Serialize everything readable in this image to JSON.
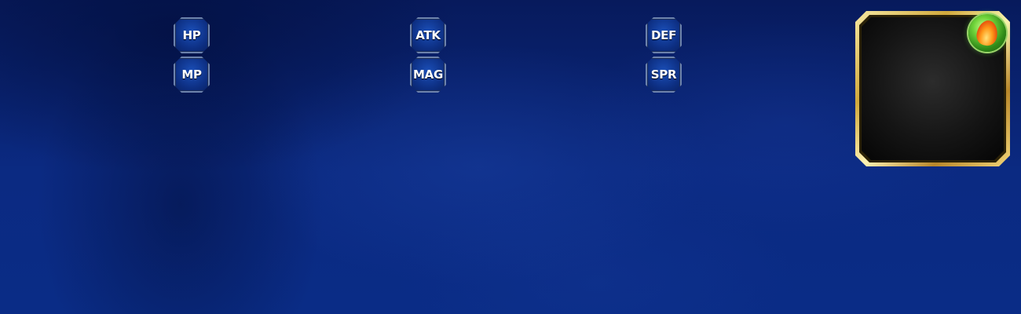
{
  "stats": {
    "hp": "HP",
    "mp": "MP",
    "atk": "ATK",
    "mag": "MAG",
    "def": "DEF",
    "spr": "SPR"
  },
  "portrait": {
    "frame_color": "#d4af37",
    "element_icon": "fire-element-icon",
    "element_orb_color": "#4cbb2a"
  },
  "theme": {
    "background_color": "#0b2a82",
    "badge_color": "#0d2f83",
    "badge_border": "#6d83ad"
  }
}
